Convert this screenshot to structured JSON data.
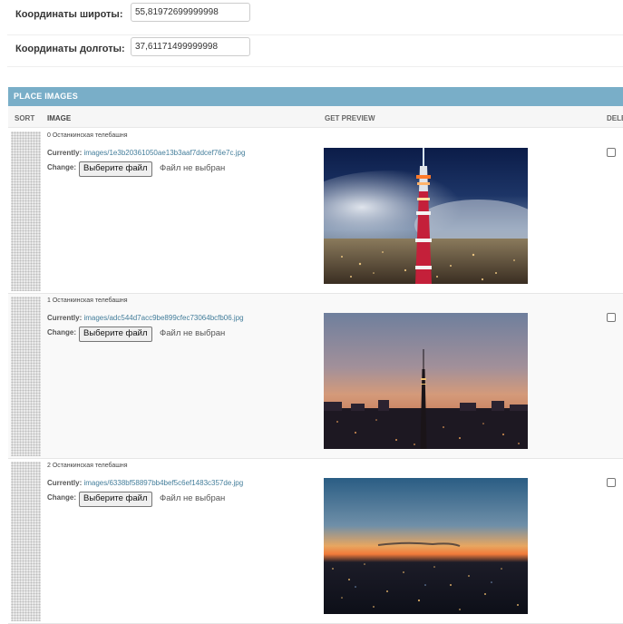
{
  "coords": {
    "lat_label": "Координаты широты:",
    "lat_value": "55,81972699999998",
    "lon_label": "Координаты долготы:",
    "lon_value": "37,61171499999998"
  },
  "inline": {
    "title": "PLACE IMAGES",
    "columns": {
      "sort": "SORT",
      "image": "IMAGE",
      "preview": "GET PREVIEW",
      "delete": "DELE"
    }
  },
  "form_labels": {
    "currently": "Currently:",
    "change": "Change:",
    "choose_file": "Выберите файл",
    "no_file": "Файл не выбран"
  },
  "items": [
    {
      "title": "0 Останкинская телебашня",
      "path": "images/1e3b20361050ae13b3aaf7ddcef76e7c.jpg",
      "preview_desc": "Ostankino tower at night above clouds"
    },
    {
      "title": "1 Останкинская телебашня",
      "path": "images/adc544d7acc9be899cfec73064bcfb06.jpg",
      "preview_desc": "Ostankino tower at dusk"
    },
    {
      "title": "2 Останкинская телебашня",
      "path": "images/6338bf58897bb4bef5c6ef1483c357de.jpg",
      "preview_desc": "Moscow skyline at sunset"
    }
  ]
}
